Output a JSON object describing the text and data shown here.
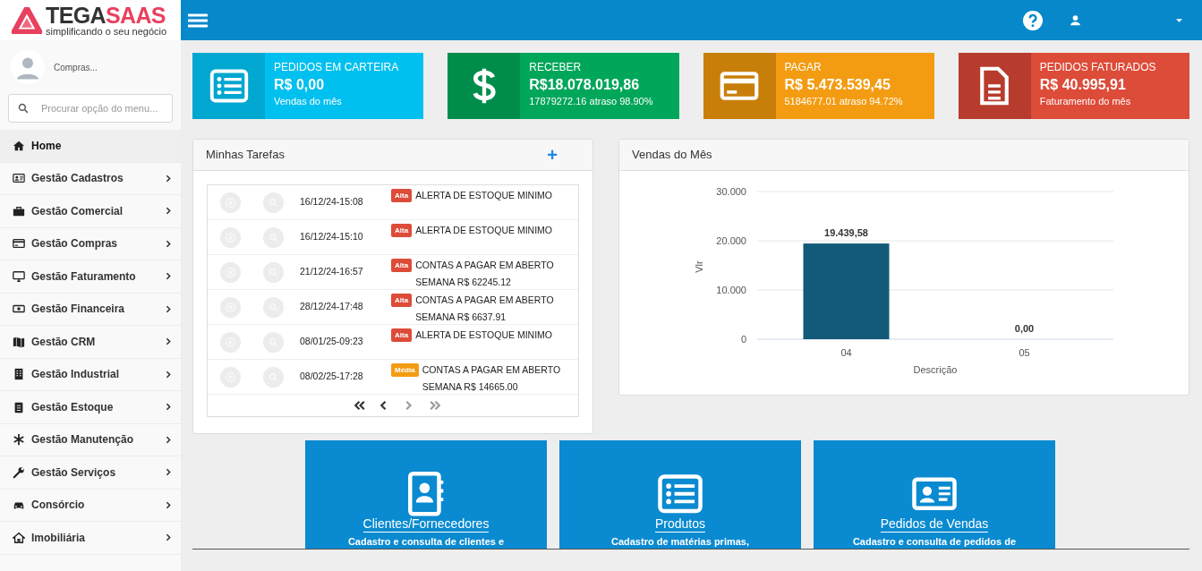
{
  "logo": {
    "name_part_1": "TEGA",
    "name_part_2": "SAAS",
    "tagline": "simplificando o seu negócio"
  },
  "user_panel": {
    "name": "Compras..."
  },
  "menu_search": {
    "placeholder": "Procurar opção do menu..."
  },
  "sidebar": {
    "items": [
      {
        "label": "Home",
        "kind": "home",
        "selected": true,
        "expandable": false
      },
      {
        "label": "Gestão Cadastros",
        "kind": "idcard",
        "selected": false,
        "expandable": true
      },
      {
        "label": "Gestão Comercial",
        "kind": "briefcase",
        "selected": false,
        "expandable": true
      },
      {
        "label": "Gestão Compras",
        "kind": "card",
        "selected": false,
        "expandable": true
      },
      {
        "label": "Gestão Faturamento",
        "kind": "monitor",
        "selected": false,
        "expandable": true
      },
      {
        "label": "Gestão Financeira",
        "kind": "money",
        "selected": false,
        "expandable": true
      },
      {
        "label": "Gestão CRM",
        "kind": "map",
        "selected": false,
        "expandable": true
      },
      {
        "label": "Gestão Industrial",
        "kind": "building",
        "selected": false,
        "expandable": true
      },
      {
        "label": "Gestão Estoque",
        "kind": "clipboard",
        "selected": false,
        "expandable": true
      },
      {
        "label": "Gestão Manutenção",
        "kind": "asterisk",
        "selected": false,
        "expandable": true
      },
      {
        "label": "Gestão Serviços",
        "kind": "wrench",
        "selected": false,
        "expandable": true
      },
      {
        "label": "Consórcio",
        "kind": "car",
        "selected": false,
        "expandable": true
      },
      {
        "label": "Imobiliária",
        "kind": "house",
        "selected": false,
        "expandable": true
      }
    ]
  },
  "stat_cards": [
    {
      "title": "PEDIDOS EM CARTEIRA",
      "value": "R$ 0,00",
      "subtitle": "Vendas do mês",
      "kind": "list",
      "color": "#00c0ef"
    },
    {
      "title": "RECEBER",
      "value": "R$18.078.019,86",
      "subtitle": "17879272.16 atraso 98.90%",
      "kind": "dollar",
      "color": "#00a65a"
    },
    {
      "title": "PAGAR",
      "value": "R$ 5.473.539,45",
      "subtitle": "5184677.01 atraso 94.72%",
      "kind": "card",
      "color": "#f39c12"
    },
    {
      "title": "PEDIDOS FATURADOS",
      "value": "R$ 40.995,91",
      "subtitle": "Faturamento do mês",
      "kind": "file",
      "color": "#dd4b39"
    }
  ],
  "tasks_panel": {
    "title": "Minhas Tarefas",
    "add_button": "+",
    "tasks": [
      {
        "date": "16/12/24-15:08",
        "priority": "Alta",
        "color": "#dd4b39",
        "description": "ALERTA DE ESTOQUE MINIMO"
      },
      {
        "date": "16/12/24-15:10",
        "priority": "Alta",
        "color": "#dd4b39",
        "description": "ALERTA DE ESTOQUE MINIMO"
      },
      {
        "date": "21/12/24-16:57",
        "priority": "Alta",
        "color": "#dd4b39",
        "description": "CONTAS A PAGAR EM ABERTO SEMANA R$ 62245.12"
      },
      {
        "date": "28/12/24-17:48",
        "priority": "Alta",
        "color": "#dd4b39",
        "description": "CONTAS A PAGAR EM ABERTO SEMANA R$ 6637.91"
      },
      {
        "date": "08/01/25-09:23",
        "priority": "Alta",
        "color": "#dd4b39",
        "description": "ALERTA DE ESTOQUE MINIMO"
      },
      {
        "date": "08/02/25-17:28",
        "priority": "Média",
        "color": "#f39c12",
        "description": "CONTAS A PAGAR EM ABERTO SEMANA R$ 14665.00"
      }
    ],
    "pagination": [
      {
        "kind": "first",
        "disabled": false
      },
      {
        "kind": "prev",
        "disabled": false
      },
      {
        "kind": "next",
        "disabled": true
      },
      {
        "kind": "last",
        "disabled": true
      }
    ]
  },
  "sales_panel": {
    "title": "Vendas do Mês",
    "chart_data": {
      "type": "bar",
      "xlabel": "Descrição",
      "ylabel": "Vlr",
      "categories": [
        "04",
        "05"
      ],
      "series": [
        {
          "color": "#125a78",
          "values": [
            19439.58,
            0
          ]
        }
      ],
      "ylim": [
        0,
        30000
      ],
      "yticks": [
        {
          "value": 0,
          "label": "0"
        },
        {
          "value": 10000,
          "label": "10.000"
        },
        {
          "value": 20000,
          "label": "20.000"
        },
        {
          "value": 30000,
          "label": "30.000"
        }
      ],
      "value_labels": [
        "19.439,58",
        "0,00"
      ]
    }
  },
  "shortcut_tiles": [
    {
      "title": "Clientes/Fornecedores",
      "description": "Cadastro e consulta de clientes e",
      "kind": "contacts"
    },
    {
      "title": "Produtos",
      "description": "Cadastro de matérias primas,",
      "kind": "list"
    },
    {
      "title": "Pedidos de Vendas",
      "description": "Cadastro e consulta de pedidos de",
      "kind": "idcard"
    }
  ]
}
